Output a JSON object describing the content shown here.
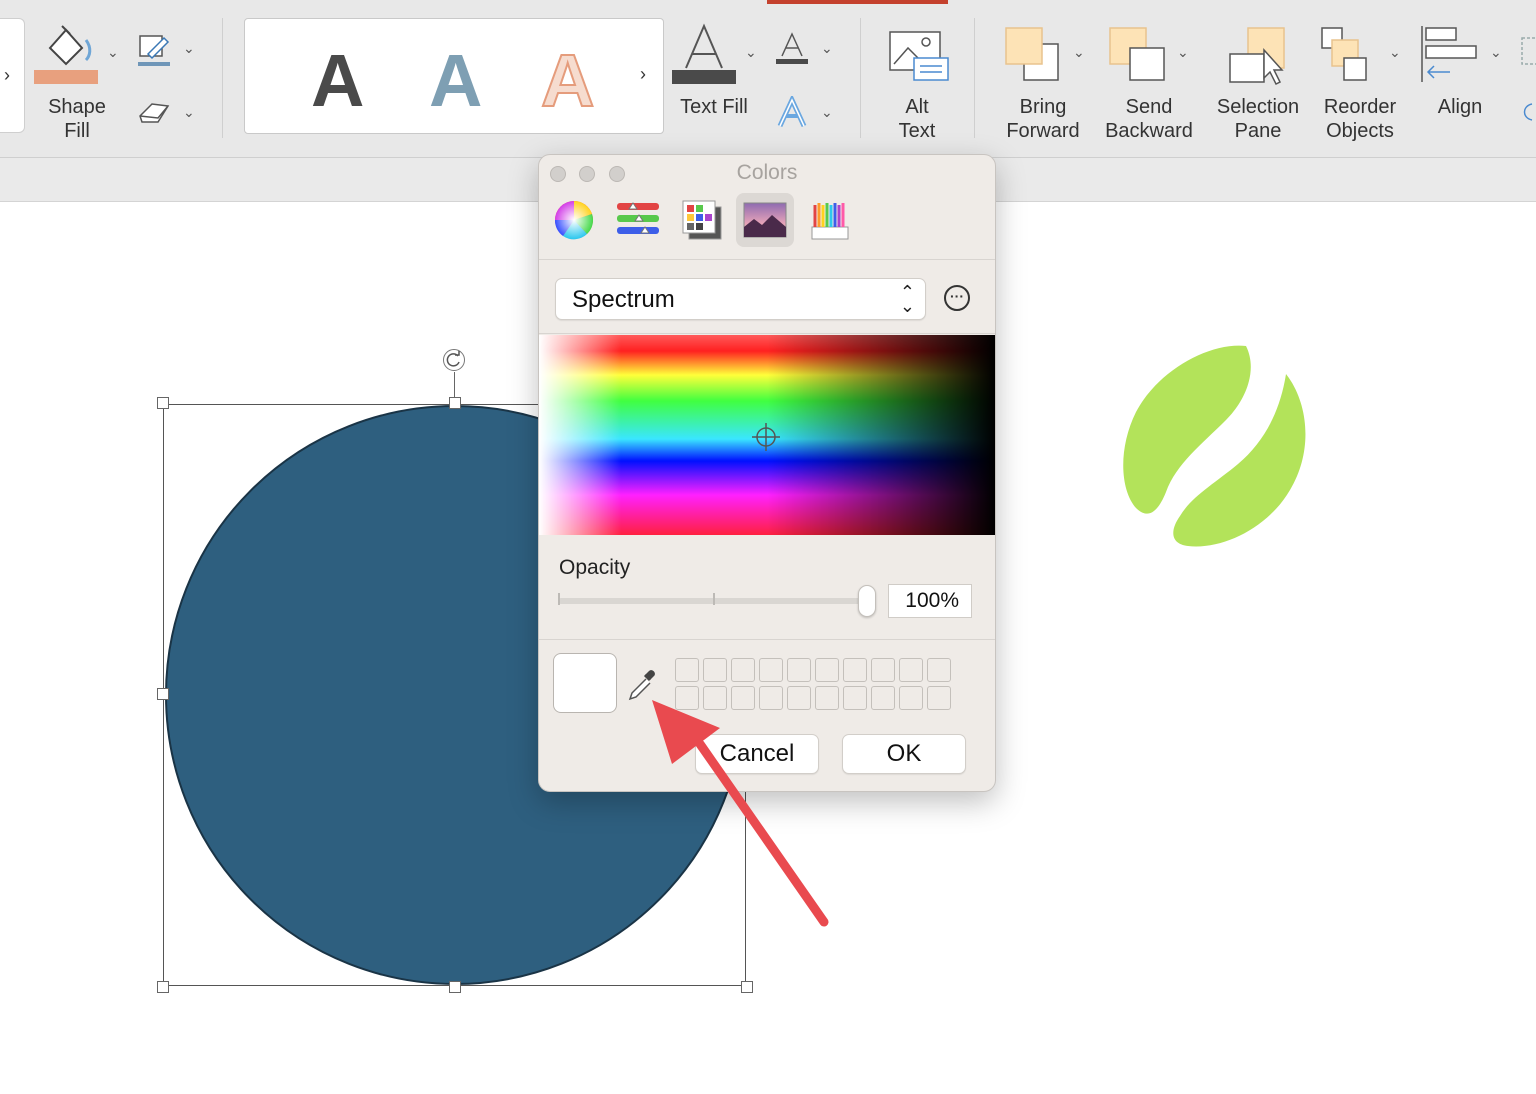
{
  "ribbon": {
    "shape_fill_label": "Shape Fill",
    "shape_fill_line1": "Shape",
    "shape_fill_line2": "Fill",
    "text_fill_label": "Text Fill",
    "alt_text_line1": "Alt",
    "alt_text_line2": "Text",
    "bring_forward_line1": "Bring",
    "bring_forward_line2": "Forward",
    "send_backward_line1": "Send",
    "send_backward_line2": "Backward",
    "selection_pane_line1": "Selection",
    "selection_pane_line2": "Pane",
    "reorder_objects_line1": "Reorder",
    "reorder_objects_line2": "Objects",
    "align_label": "Align",
    "wordart_styles": [
      {
        "glyph": "A",
        "color": "#4a4a4a"
      },
      {
        "glyph": "A",
        "color": "#7e9fb3"
      },
      {
        "glyph": "A",
        "color": "#f1c7b3"
      }
    ],
    "accent_color": "#c4412d"
  },
  "canvas": {
    "circle_fill": "#2e5f7f",
    "bean_color": "#b3e35a"
  },
  "colors_dialog": {
    "title": "Colors",
    "mode_tabs": [
      "color-wheel",
      "color-sliders",
      "color-palettes",
      "image-palettes",
      "pencils"
    ],
    "active_mode": "image-palettes",
    "palette_select_value": "Spectrum",
    "opacity_label": "Opacity",
    "opacity_value": "100%",
    "opacity_level": 1.0,
    "current_color": "#ffffff",
    "cancel_label": "Cancel",
    "ok_label": "OK"
  },
  "annotation": {
    "arrow_color": "#e94a4f",
    "points_to": "eyedropper-button"
  }
}
